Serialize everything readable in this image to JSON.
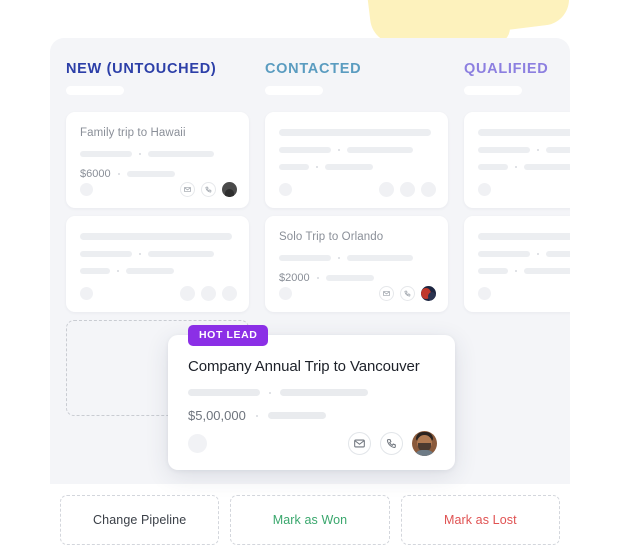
{
  "decor": {
    "blob_color": "#fdf2bd"
  },
  "board": {
    "background": "#f4f5f8",
    "columns": [
      {
        "title": "NEW (UNTOUCHED)",
        "color": "#2c3fa8",
        "cards": [
          {
            "title": "Family trip to Hawaii",
            "price": "$6000",
            "skeleton": false,
            "avatar": "a1"
          },
          {
            "title": "",
            "price": "",
            "skeleton": true,
            "avatar": ""
          }
        ]
      },
      {
        "title": "CONTACTED",
        "color": "#5a9cc0",
        "cards": [
          {
            "title": "",
            "price": "",
            "skeleton": true,
            "avatar": ""
          },
          {
            "title": "Solo Trip to Orlando",
            "price": "$2000",
            "skeleton": false,
            "avatar": "a2"
          }
        ]
      },
      {
        "title": "QUALIFIED",
        "color": "#8c7fe0",
        "cards": [
          {
            "title": "",
            "price": "",
            "skeleton": true,
            "avatar": ""
          },
          {
            "title": "",
            "price": "",
            "skeleton": true,
            "avatar": ""
          }
        ]
      }
    ]
  },
  "hot_card": {
    "badge": "HOT LEAD",
    "badge_color": "#8b2fe6",
    "title": "Company Annual Trip to Vancouver",
    "price": "$5,00,000",
    "email_icon": "envelope-icon",
    "phone_icon": "phone-icon",
    "avatar": "user-avatar"
  },
  "actions": [
    {
      "label": "Change Pipeline",
      "style": "neutral",
      "color": "#3b4048"
    },
    {
      "label": "Mark as Won",
      "style": "won",
      "color": "#3aa76d"
    },
    {
      "label": "Mark as Lost",
      "style": "lost",
      "color": "#e05252"
    }
  ]
}
